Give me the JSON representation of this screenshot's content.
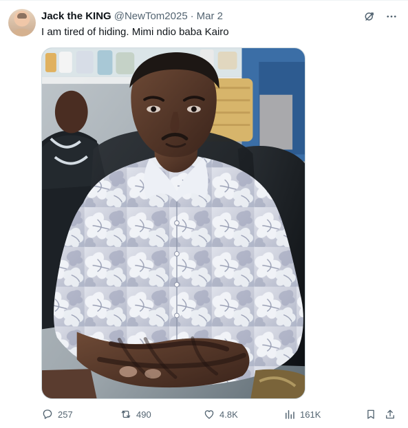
{
  "tweet": {
    "display_name": "Jack the KING",
    "handle": "@NewTom2025",
    "separator": "·",
    "date": "Mar 2",
    "text": "I am tired of hiding. Mimi ndio baba Kairo"
  },
  "icons": {
    "top": [
      "grok-icon",
      "more-icon"
    ],
    "actions": [
      "reply-icon",
      "repost-icon",
      "like-icon",
      "views-icon",
      "bookmark-icon",
      "share-icon"
    ]
  },
  "metrics": {
    "replies": "257",
    "reposts": "490",
    "likes": "4.8K",
    "views": "161K"
  },
  "colors": {
    "primary_text": "#0f1419",
    "secondary_text": "#536471",
    "border": "#cfd9de",
    "accent": "#1d9bf0"
  }
}
